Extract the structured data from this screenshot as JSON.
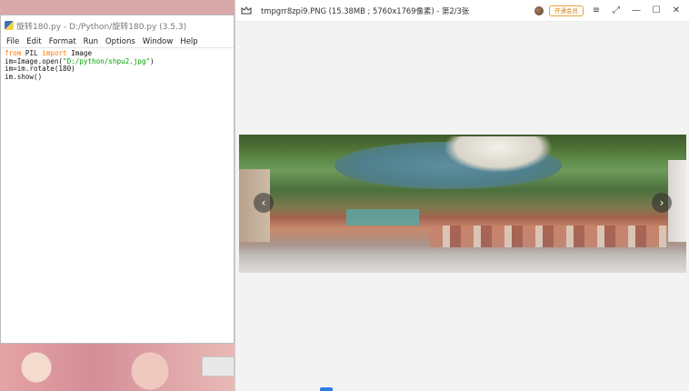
{
  "idle": {
    "title": "旋转180.py - D:/Python/旋转180.py (3.5.3)",
    "menu": [
      "File",
      "Edit",
      "Format",
      "Run",
      "Options",
      "Window",
      "Help"
    ],
    "code": {
      "line1_kw1": "from",
      "line1_mid": " PIL ",
      "line1_kw2": "import",
      "line1_end": " Image",
      "line2_start": "im=Image.open(",
      "line2_str": "\"D:/python/shpu2.jpg\"",
      "line2_end": ")",
      "line3": "im=im.rotate(180)",
      "line4": "im.show()"
    }
  },
  "viewer": {
    "title": "tmpgrr8zpi9.PNG (15.38MB ; 5760x1769像素) - 第2/3张",
    "vip_label": "开通会员",
    "controls": {
      "menu": "≡",
      "fullscreen": "⤢",
      "minimize": "—",
      "maximize": "☐",
      "close": "✕"
    },
    "prev_arrow": "‹",
    "next_arrow": "›"
  },
  "colors": {
    "accent": "#2f7de1",
    "vip": "#d18518",
    "keyword": "#ff7700",
    "string": "#00a000"
  }
}
